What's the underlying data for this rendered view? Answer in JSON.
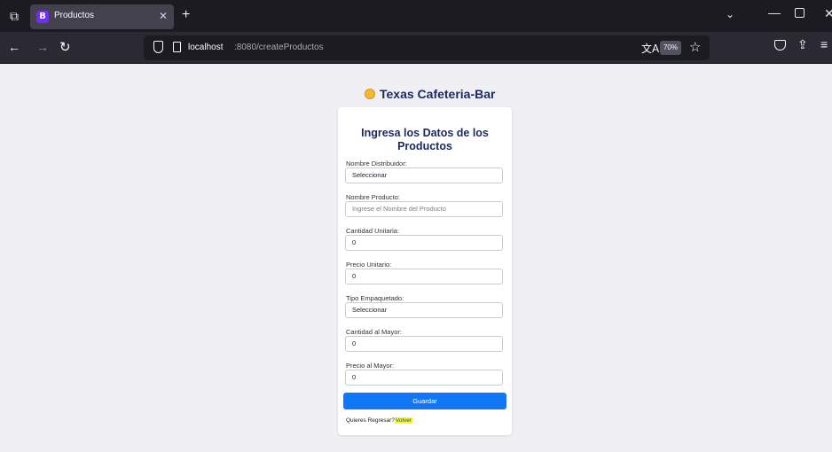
{
  "browser": {
    "tab_title": "Productos",
    "tab_favicon_letter": "B",
    "url_host": "localhost",
    "url_path": ":8080/createProductos",
    "zoom": "70%",
    "icons": {
      "tabs_menu": "tabs-icon",
      "close": "close-icon",
      "new_tab": "plus-icon",
      "back": "arrow-left-icon",
      "forward": "arrow-right-icon",
      "reload": "reload-icon",
      "translate": "translate-icon",
      "bookmark": "star-icon"
    }
  },
  "page": {
    "brand": "Texas Cafeteria-Bar",
    "form_title_line1": "Ingresa los Datos de los",
    "form_title_line2": "Productos",
    "fields": {
      "distribuidor": {
        "label": "Nombre Distribuidor:",
        "value": "Seleccionar"
      },
      "producto": {
        "label": "Nombre Producto:",
        "placeholder": "Ingrese el Nombre del Producto"
      },
      "cantidad_unitaria": {
        "label": "Cantidad Unitaria:",
        "value": "0"
      },
      "precio_unitario": {
        "label": "Precio Unitario:",
        "value": "0"
      },
      "tipo_empaquetado": {
        "label": "Tipo Empaquetado:",
        "value": "Seleccionar"
      },
      "cantidad_mayor": {
        "label": "Cantidad al Mayor:",
        "value": "0"
      },
      "precio_mayor": {
        "label": "Precio al Mayor:",
        "value": "0"
      }
    },
    "submit": "Guardar",
    "back_prompt": "Quieres Regresar?",
    "back_link": "Volver"
  },
  "colors": {
    "accent": "#1177f7",
    "title": "#1b2a5c",
    "highlight": "#ffff00"
  }
}
